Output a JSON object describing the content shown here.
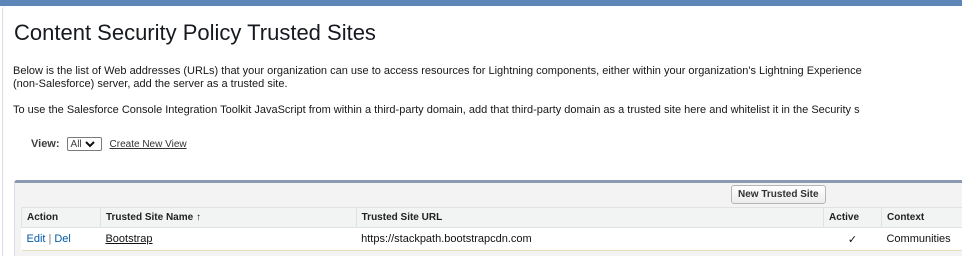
{
  "page": {
    "title": "Content Security Policy Trusted Sites",
    "intro_line1": "Below is the list of Web addresses (URLs) that your organization can use to access resources for Lightning components, either within your organization's Lightning Experience",
    "intro_line2": "(non-Salesforce) server, add the server as a trusted site.",
    "intro_line3": "To use the Salesforce Console Integration Toolkit JavaScript from within a third-party domain, add that third-party domain as a trusted site here and whitelist it in the Security s"
  },
  "view": {
    "label": "View:",
    "selected": "All",
    "create_link": "Create New View"
  },
  "list": {
    "new_button": "New Trusted Site",
    "columns": {
      "action": "Action",
      "name": "Trusted Site Name ↑",
      "url": "Trusted Site URL",
      "active": "Active",
      "context": "Context"
    },
    "rows": [
      {
        "edit": "Edit",
        "separator": "|",
        "del": "Del",
        "name": "Bootstrap",
        "url": "https://stackpath.bootstrapcdn.com",
        "active": "✓",
        "context": "Communities"
      }
    ]
  }
}
